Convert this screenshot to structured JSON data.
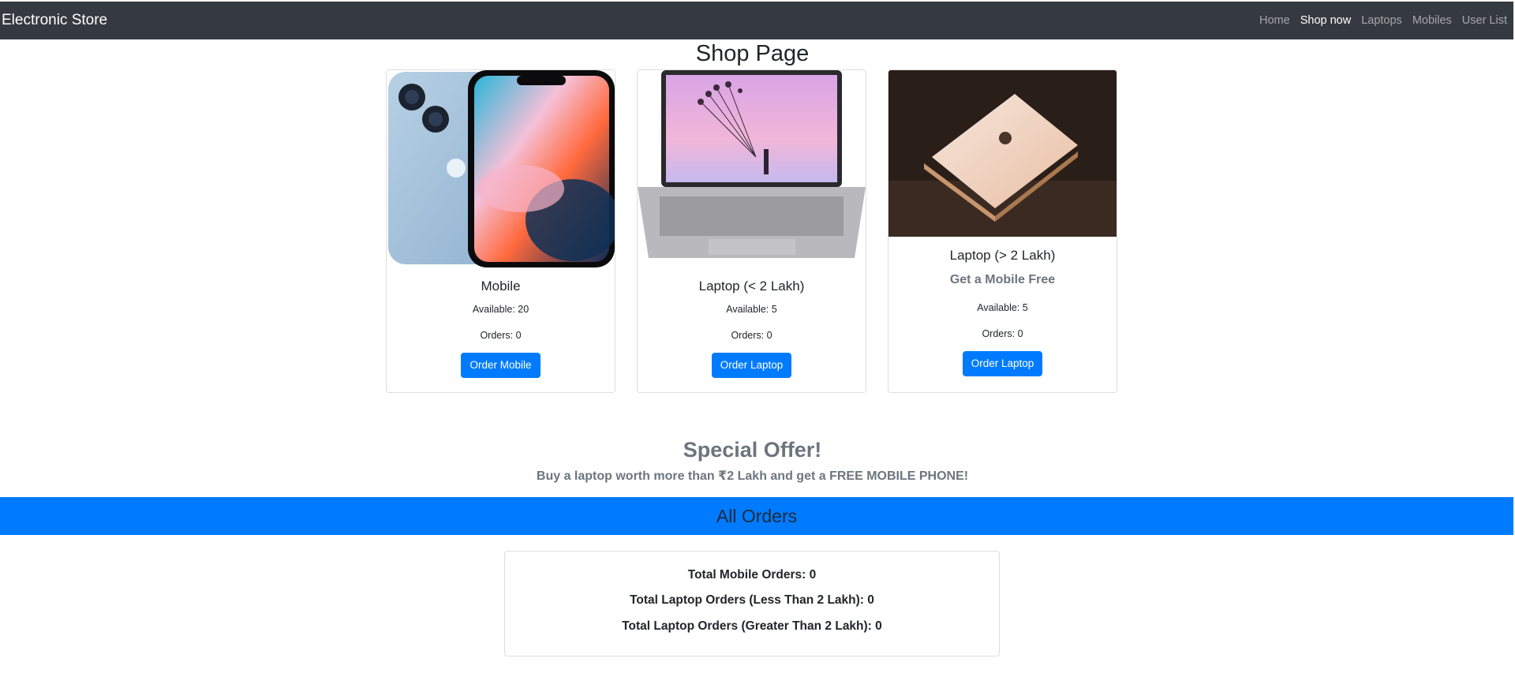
{
  "navbar": {
    "brand": "Electronic Store",
    "links": [
      {
        "label": "Home",
        "active": false
      },
      {
        "label": "Shop now",
        "active": true
      },
      {
        "label": "Laptops",
        "active": false
      },
      {
        "label": "Mobiles",
        "active": false
      },
      {
        "label": "User List",
        "active": false
      }
    ]
  },
  "page_title": "Shop Page",
  "products": [
    {
      "title": "Mobile",
      "subtitle": "",
      "available": "Available: 20",
      "orders": "Orders: 0",
      "button": "Order Mobile",
      "image_icon": "phone-product-icon"
    },
    {
      "title": "Laptop (< 2 Lakh)",
      "subtitle": "",
      "available": "Available: 5",
      "orders": "Orders: 0",
      "button": "Order Laptop",
      "image_icon": "laptop-product-icon"
    },
    {
      "title": "Laptop (> 2 Lakh)",
      "subtitle": "Get a Mobile Free",
      "available": "Available: 5",
      "orders": "Orders: 0",
      "button": "Order Laptop",
      "image_icon": "premium-laptop-product-icon"
    }
  ],
  "offer": {
    "title": "Special Offer!",
    "text": "Buy a laptop worth more than ₹2 Lakh and get a FREE MOBILE PHONE!"
  },
  "orders_section": {
    "title": "All Orders",
    "lines": [
      "Total Mobile Orders: 0",
      "Total Laptop Orders (Less Than 2 Lakh): 0",
      "Total Laptop Orders (Greater Than 2 Lakh): 0"
    ]
  },
  "colors": {
    "navbar": "#343a40",
    "primary": "#007bff",
    "muted": "#6c757d"
  }
}
